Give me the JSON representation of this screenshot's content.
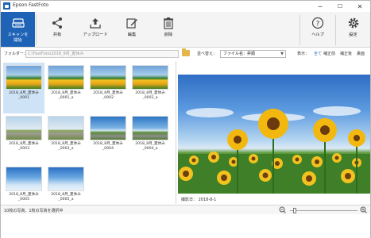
{
  "window": {
    "title": "Epson FastFoto",
    "minimize_glyph": "─",
    "maximize_glyph": "☐",
    "close_glyph": "✕"
  },
  "toolbar": {
    "scan_label": "スキャンを\n開始",
    "share_label": "共有",
    "upload_label": "アップロード",
    "edit_label": "編集",
    "delete_label": "削除",
    "help_label": "ヘルプ",
    "settings_label": "設定"
  },
  "filter": {
    "folder_label": "フォルダー：",
    "folder_value": "C:\\FastFoto\\2018_8月_夏休み",
    "sort_label": "並べ替え：",
    "sort_value": "ファイル名：昇順",
    "display_label": "表示：",
    "options": [
      "全て",
      "補正前",
      "補正後",
      "裏面"
    ],
    "active_option": "全て"
  },
  "thumbnails": [
    {
      "caption": "2018_8月_夏休み\n_0001",
      "image": "sunflowers",
      "selected": true
    },
    {
      "caption": "2018_8月_夏休み\n_0001_a",
      "image": "sunflowers"
    },
    {
      "caption": "2018_8月_夏休み\n_0002",
      "image": "sunflowers"
    },
    {
      "caption": "2018_8月_夏休み\n_0002_a",
      "image": "sunflowers"
    },
    {
      "caption": "2018_8月_夏休み\n_0003",
      "image": "cyclist"
    },
    {
      "caption": "2018_8月_夏休み\n_0003_a",
      "image": "cyclist"
    },
    {
      "caption": "2018_8月_夏休み\n_0004",
      "image": "road"
    },
    {
      "caption": "2018_8月_夏休み\n_0004_a",
      "image": "road"
    },
    {
      "caption": "2018_8月_夏休み\n_0005",
      "image": "sky"
    },
    {
      "caption": "2018_8月_夏休み\n_0005_a",
      "image": "sky"
    }
  ],
  "preview": {
    "image": "sunflowers",
    "shoot_date": "撮影日： 2018-8-1"
  },
  "status": {
    "text": "10枚の写真、1枚の写真を選択中",
    "zoom_level": 0.05
  },
  "colors": {
    "accent": "#1e63b6",
    "folder_icon": "#e4b64b"
  }
}
